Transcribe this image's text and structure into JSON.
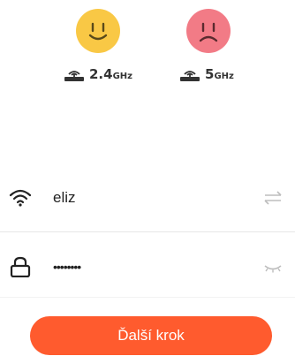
{
  "bands": [
    {
      "value": "2.4",
      "unit": "GHz",
      "status": "happy",
      "face_color": "#f9c845"
    },
    {
      "value": "5",
      "unit": "GHz",
      "status": "sad",
      "face_color": "#f27b86"
    }
  ],
  "icons": {
    "router": "router-icon",
    "wifi": "wifi-icon",
    "lock": "lock-icon",
    "switch": "switch-arrows-icon",
    "visibility": "eye-closed-icon"
  },
  "network": {
    "ssid": "eliz",
    "password_masked": "••••••••"
  },
  "actions": {
    "next_label": "Ďalší krok"
  },
  "colors": {
    "accent": "#ff5b2e",
    "divider": "#e6e6e6",
    "text": "#222222",
    "muted_icon": "#bdbdbd"
  }
}
